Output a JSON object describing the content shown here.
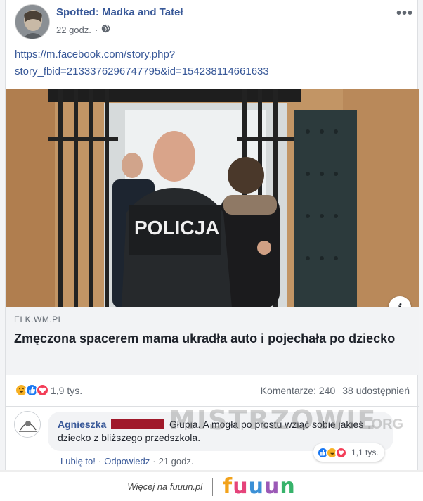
{
  "post": {
    "page_name": "Spotted: Madka and Tateł",
    "time": "22 godz.",
    "audience_icon": "globe-icon",
    "more_icon": "more-dots-icon",
    "more_label": "•••",
    "link_line1": "https://m.facebook.com/story.php?",
    "link_line2": "story_fbid=2133376296747795&id=154238114661633"
  },
  "link_preview": {
    "photo_text": "POLICJA",
    "info_label": "i",
    "domain": "ELK.WM.PL",
    "headline": "Zmęczona spacerem mama ukradła auto i pojechała po dziecko"
  },
  "stats": {
    "reaction_icons": [
      "haha-icon",
      "like-icon",
      "love-icon"
    ],
    "reaction_count": "1,9 tys.",
    "comments": "Komentarze: 240",
    "shares": "38 udostępnień"
  },
  "comment": {
    "author": "Agnieszka",
    "text": "Głupia. A mogła po prostu wziąć sobie jakieś dziecko z bliższego przedszkola.",
    "reaction_count": "1,1 tys.",
    "like_action": "Lubię to!",
    "reply_action": "Odpowiedz",
    "separator": "·",
    "time": "21 godz."
  },
  "watermark": {
    "main": "MISTRZOWIE",
    "suffix": ".ORG"
  },
  "footer": {
    "more_at": "Więcej na fuuun.pl",
    "logo_letters": [
      "f",
      "u",
      "u",
      "u",
      "n"
    ]
  },
  "colors": {
    "link_blue": "#385898",
    "like_blue": "#1877f2",
    "love_red": "#f33e58",
    "haha_yellow": "#f7b125"
  }
}
